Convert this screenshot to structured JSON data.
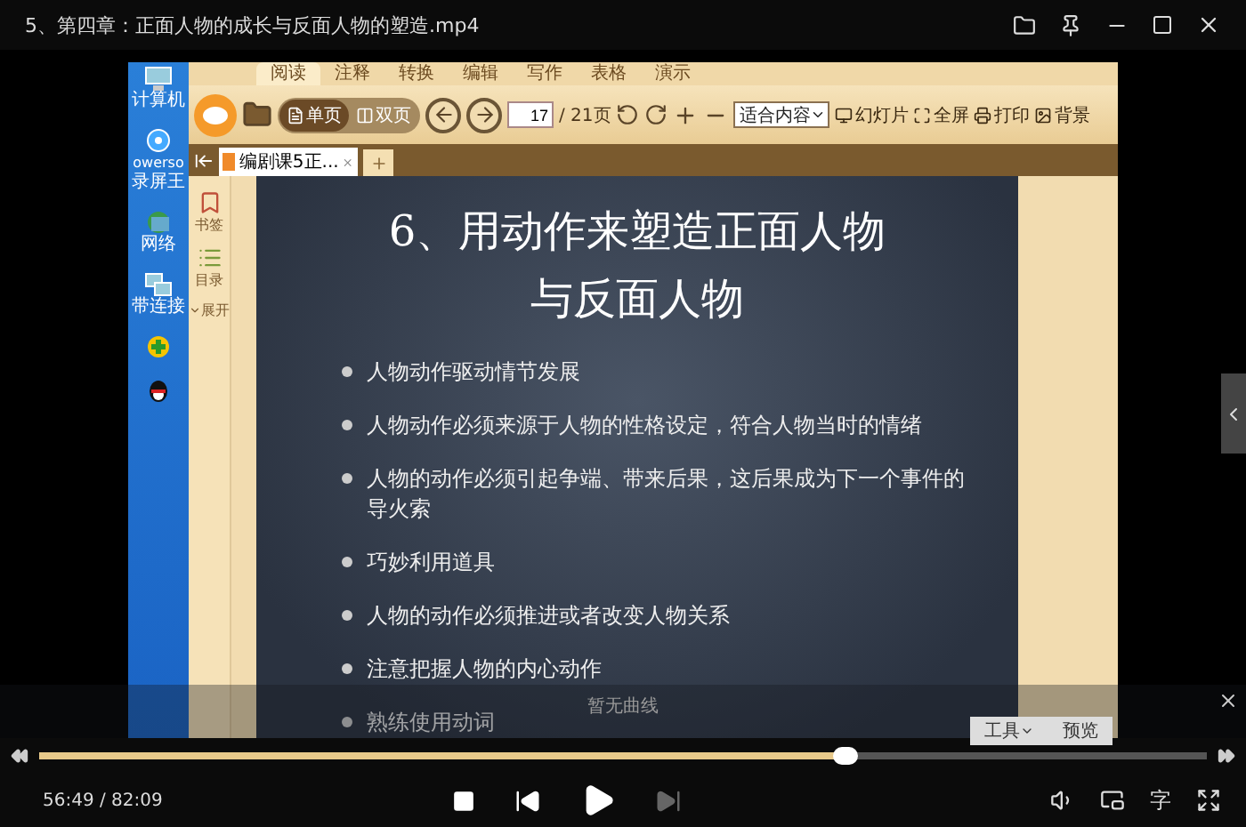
{
  "window": {
    "title": "5、第四章：正面人物的成长与反面人物的塑造.mp4"
  },
  "desktop": {
    "icons": [
      {
        "kind": "computer",
        "lines": [
          "计算机"
        ]
      },
      {
        "kind": "camera",
        "lines": [
          "owerso",
          "录屏王"
        ]
      },
      {
        "kind": "globe",
        "lines": [
          "网络"
        ]
      },
      {
        "kind": "network",
        "lines": [
          "带连接"
        ]
      },
      {
        "kind": "plus"
      },
      {
        "kind": "penguin"
      }
    ]
  },
  "reader": {
    "menu_tabs": [
      {
        "label": "阅读",
        "selected": true
      },
      {
        "label": "注释",
        "selected": false
      },
      {
        "label": "转换",
        "selected": false
      },
      {
        "label": "编辑",
        "selected": false
      },
      {
        "label": "写作",
        "selected": false
      },
      {
        "label": "表格",
        "selected": false
      },
      {
        "label": "演示",
        "selected": false
      }
    ],
    "view_modes": [
      {
        "label": "单页",
        "selected": true
      },
      {
        "label": "双页",
        "selected": false
      }
    ],
    "page": {
      "value": "17",
      "total": "/ 21页"
    },
    "zoom_select": "适合内容",
    "actions": [
      {
        "kind": "slideshow",
        "label": "幻灯片"
      },
      {
        "kind": "fullscreen",
        "label": "全屏"
      },
      {
        "kind": "print",
        "label": "打印"
      },
      {
        "kind": "background",
        "label": "背景"
      }
    ],
    "doc_tabs": [
      {
        "label": "编剧课5正...",
        "selected": true
      }
    ],
    "side_panel": [
      {
        "kind": "bookmark",
        "label": "书签"
      },
      {
        "kind": "contents",
        "label": "目录"
      }
    ],
    "expand": "展开",
    "slide": {
      "title_lines": [
        "6、用动作来塑造正面人物",
        "与反面人物"
      ],
      "bullets": [
        "人物动作驱动情节发展",
        "人物动作必须来源于人物的性格设定，符合人物当时的情绪",
        "人物的动作必须引起争端、带来后果，这后果成为下一个事件的导火索",
        "巧妙利用道具",
        "人物的动作必须推进或者改变人物关系",
        "注意把握人物的内心动作",
        "熟练使用动词"
      ]
    }
  },
  "curve_panel": {
    "message": "暂无曲线",
    "buttons": [
      {
        "kind": "dropdown",
        "label": "工具"
      },
      {
        "kind": "plain",
        "label": "预览"
      }
    ]
  },
  "player": {
    "progress": {
      "level": 0.69
    },
    "time": "56:49 / 82:09",
    "controls": [
      {
        "kind": "stop",
        "disabled": false
      },
      {
        "kind": "prev",
        "disabled": false
      },
      {
        "kind": "play",
        "disabled": false
      },
      {
        "kind": "next",
        "disabled": true
      }
    ],
    "subtitle_button": "字"
  }
}
